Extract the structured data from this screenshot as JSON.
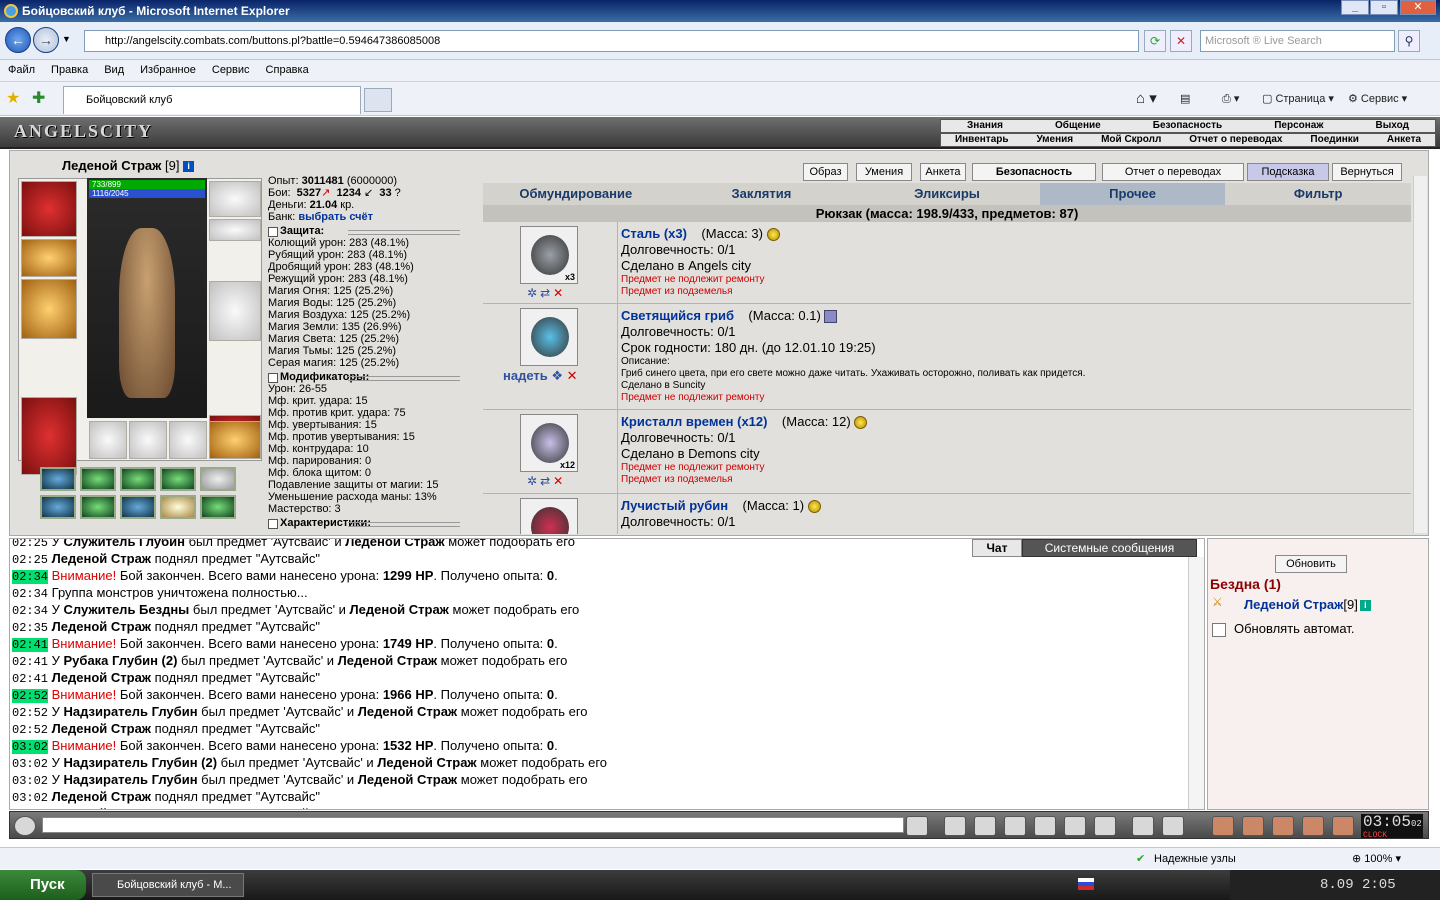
{
  "window": {
    "title": "Бойцовский клуб - Microsoft Internet Explorer"
  },
  "browser": {
    "url": "http://angelscity.combats.com/buttons.pl?battle=0.594647386085008",
    "search_placeholder": "Microsoft ® Live Search",
    "menu": [
      "Файл",
      "Правка",
      "Вид",
      "Избранное",
      "Сервис",
      "Справка"
    ],
    "tab_title": "Бойцовский клуб",
    "tools": {
      "page": "Страница",
      "service": "Сервис"
    },
    "status": {
      "trusted": "Надежные узлы",
      "zoom": "100%"
    }
  },
  "game": {
    "logo": "ANGELSCITY",
    "top_menu_1": [
      "Знания",
      "Общение",
      "Безопасность",
      "Персонаж",
      "Выход"
    ],
    "top_menu_2": [
      "Инвентарь",
      "Умения",
      "Мой Скролл",
      "Отчет о переводах",
      "Поединки",
      "Анкета"
    ],
    "character": {
      "name": "Леденой Страж",
      "level": "[9]",
      "hp": "733/899",
      "mana": "1116/2045"
    },
    "buttons": [
      "Образ",
      "Умения",
      "Анкета",
      "Безопасность",
      "Отчет о переводах",
      "Подсказка",
      "Вернуться"
    ],
    "stats": {
      "exp_label": "Опыт:",
      "exp": "3011481",
      "exp_next": "(6000000)",
      "fights_label": "Бои:",
      "wins": "5327",
      "losses": "1234",
      "draws": "33",
      "money_label": "Деньги:",
      "money": "21.04",
      "money_unit": "кр.",
      "bank_label": "Банк:",
      "bank_link": "выбрать счёт"
    },
    "defense_title": "Защита:",
    "defense": [
      "Колющий урон: 283 (48.1%)",
      "Рубящий урон: 283 (48.1%)",
      "Дробящий урон: 283 (48.1%)",
      "Режущий урон: 283 (48.1%)",
      "Магия Огня: 125 (25.2%)",
      "Магия Воды: 125 (25.2%)",
      "Магия Воздуха: 125 (25.2%)",
      "Магия Земли: 135 (26.9%)",
      "Магия Света: 125 (25.2%)",
      "Магия Тьмы: 125 (25.2%)",
      "Серая магия: 125 (25.2%)"
    ],
    "modifiers_title": "Модификаторы:",
    "modifiers": [
      "Урон: 26-55",
      "Мф. крит. удара: 15",
      "Мф. против крит. удара: 75",
      "Мф. увертывания: 15",
      "Мф. против увертывания: 15",
      "Мф. контрудара: 10",
      "Мф. парирования: 0",
      "Мф. блока щитом: 0",
      "Подавление защиты от магии: 15",
      "Уменьшение расхода маны: 13%",
      "Мастерство: 3"
    ],
    "characteristics_title": "Характеристики:",
    "inv_tabs": [
      "Обмундирование",
      "Заклятия",
      "Эликсиры",
      "Прочее",
      "Фильтр"
    ],
    "pack_header": "Рюкзак (масса: 198.9/433, предметов: 87)",
    "items": [
      {
        "name": "Сталь (x3)",
        "mass": "(Масса: 3)",
        "count": "x3",
        "lines": [
          "Долговечность: 0/1",
          "Сделано в Angels city"
        ],
        "small": [],
        "red": [
          "Предмет не подлежит ремонту",
          "Предмет из подземелья"
        ],
        "color": "#9aa0a8"
      },
      {
        "name": "Светящийся гриб",
        "mass": "(Масса: 0.1)",
        "count": "",
        "action": "надеть",
        "lines": [
          "Долговечность: 0/1",
          "Срок годности: 180 дн. (до 12.01.10 19:25)"
        ],
        "small": [
          "Описание:",
          "Гриб синего цвета, при его свете можно даже читать. Ухаживать осторожно, поливать как придется.",
          "Сделано в Suncity"
        ],
        "red": [
          "Предмет не подлежит ремонту"
        ],
        "color": "#5ac0e8"
      },
      {
        "name": "Кристалл времен (x12)",
        "mass": "(Масса: 12)",
        "count": "x12",
        "lines": [
          "Долговечность: 0/1",
          "Сделано в Demons city"
        ],
        "small": [],
        "red": [
          "Предмет не подлежит ремонту",
          "Предмет из подземелья"
        ],
        "color": "#c8c0e8"
      },
      {
        "name": "Лучистый рубин",
        "mass": "(Масса: 1)",
        "count": "",
        "lines": [
          "Долговечность: 0/1"
        ],
        "small": [],
        "red": [],
        "color": "#d03050"
      }
    ],
    "chat_tabs": {
      "chat": "Чат",
      "system": "Системные сообщения"
    },
    "chat": [
      {
        "t": "02:25",
        "hl": false,
        "parts": [
          [
            "",
            "У "
          ],
          [
            "b",
            "Служитель Глубин"
          ],
          [
            "",
            " был предмет 'Аутсвайс' и "
          ],
          [
            "b",
            "Леденой Страж"
          ],
          [
            "",
            " может подобрать его"
          ]
        ]
      },
      {
        "t": "02:25",
        "hl": false,
        "parts": [
          [
            "b",
            "Леденой Страж"
          ],
          [
            "",
            " поднял предмет \"Аутсвайс\""
          ]
        ]
      },
      {
        "t": "02:34",
        "hl": true,
        "parts": [
          [
            "w",
            "Внимание!"
          ],
          [
            "",
            " Бой закончен. Всего вами нанесено урона: "
          ],
          [
            "b",
            "1299 HP"
          ],
          [
            "",
            ". Получено опыта: "
          ],
          [
            "b",
            "0"
          ],
          [
            "",
            "."
          ]
        ]
      },
      {
        "t": "02:34",
        "hl": false,
        "parts": [
          [
            "",
            "Группа монстров уничтожена полностью..."
          ]
        ]
      },
      {
        "t": "02:34",
        "hl": false,
        "parts": [
          [
            "",
            "У "
          ],
          [
            "b",
            "Служитель Бездны"
          ],
          [
            "",
            " был предмет 'Аутсвайс' и "
          ],
          [
            "b",
            "Леденой Страж"
          ],
          [
            "",
            " может подобрать его"
          ]
        ]
      },
      {
        "t": "02:35",
        "hl": false,
        "parts": [
          [
            "b",
            "Леденой Страж"
          ],
          [
            "",
            " поднял предмет \"Аутсвайс\""
          ]
        ]
      },
      {
        "t": "02:41",
        "hl": true,
        "parts": [
          [
            "w",
            "Внимание!"
          ],
          [
            "",
            " Бой закончен. Всего вами нанесено урона: "
          ],
          [
            "b",
            "1749 HP"
          ],
          [
            "",
            ". Получено опыта: "
          ],
          [
            "b",
            "0"
          ],
          [
            "",
            "."
          ]
        ]
      },
      {
        "t": "02:41",
        "hl": false,
        "parts": [
          [
            "",
            "У "
          ],
          [
            "b",
            "Рубака Глубин (2)"
          ],
          [
            "",
            " был предмет 'Аутсвайс' и "
          ],
          [
            "b",
            "Леденой Страж"
          ],
          [
            "",
            " может подобрать его"
          ]
        ]
      },
      {
        "t": "02:41",
        "hl": false,
        "parts": [
          [
            "b",
            "Леденой Страж"
          ],
          [
            "",
            " поднял предмет \"Аутсвайс\""
          ]
        ]
      },
      {
        "t": "02:52",
        "hl": true,
        "parts": [
          [
            "w",
            "Внимание!"
          ],
          [
            "",
            " Бой закончен. Всего вами нанесено урона: "
          ],
          [
            "b",
            "1966 HP"
          ],
          [
            "",
            ". Получено опыта: "
          ],
          [
            "b",
            "0"
          ],
          [
            "",
            "."
          ]
        ]
      },
      {
        "t": "02:52",
        "hl": false,
        "parts": [
          [
            "",
            "У "
          ],
          [
            "b",
            "Надзиратель Глубин"
          ],
          [
            "",
            " был предмет 'Аутсвайс' и "
          ],
          [
            "b",
            "Леденой Страж"
          ],
          [
            "",
            " может подобрать его"
          ]
        ]
      },
      {
        "t": "02:52",
        "hl": false,
        "parts": [
          [
            "b",
            "Леденой Страж"
          ],
          [
            "",
            " поднял предмет \"Аутсвайс\""
          ]
        ]
      },
      {
        "t": "03:02",
        "hl": true,
        "parts": [
          [
            "w",
            "Внимание!"
          ],
          [
            "",
            " Бой закончен. Всего вами нанесено урона: "
          ],
          [
            "b",
            "1532 HP"
          ],
          [
            "",
            ". Получено опыта: "
          ],
          [
            "b",
            "0"
          ],
          [
            "",
            "."
          ]
        ]
      },
      {
        "t": "03:02",
        "hl": false,
        "parts": [
          [
            "",
            "У "
          ],
          [
            "b",
            "Надзиратель Глубин (2)"
          ],
          [
            "",
            " был предмет 'Аутсвайс' и "
          ],
          [
            "b",
            "Леденой Страж"
          ],
          [
            "",
            " может подобрать его"
          ]
        ]
      },
      {
        "t": "03:02",
        "hl": false,
        "parts": [
          [
            "",
            "У "
          ],
          [
            "b",
            "Надзиратель Глубин"
          ],
          [
            "",
            " был предмет 'Аутсвайс' и "
          ],
          [
            "b",
            "Леденой Страж"
          ],
          [
            "",
            " может подобрать его"
          ]
        ]
      },
      {
        "t": "03:02",
        "hl": false,
        "parts": [
          [
            "b",
            "Леденой Страж"
          ],
          [
            "",
            " поднял предмет \"Аутсвайс\""
          ]
        ]
      },
      {
        "t": "03:02",
        "hl": false,
        "parts": [
          [
            "b",
            "Леденой Страж"
          ],
          [
            "",
            " поднял предмет \"Аутсвайс\""
          ]
        ]
      }
    ],
    "right_panel": {
      "refresh": "Обновить",
      "location": "Бездна (1)",
      "player": "Леденой Страж",
      "player_level": "[9]",
      "auto_update": "Обновлять автомат."
    },
    "clock": {
      "time": "03:05",
      "sec": "02",
      "label": "CLOCK"
    }
  },
  "taskbar": {
    "start": "Пуск",
    "task": "Бойцовский клуб - М...",
    "time": "8.09  2:05"
  }
}
